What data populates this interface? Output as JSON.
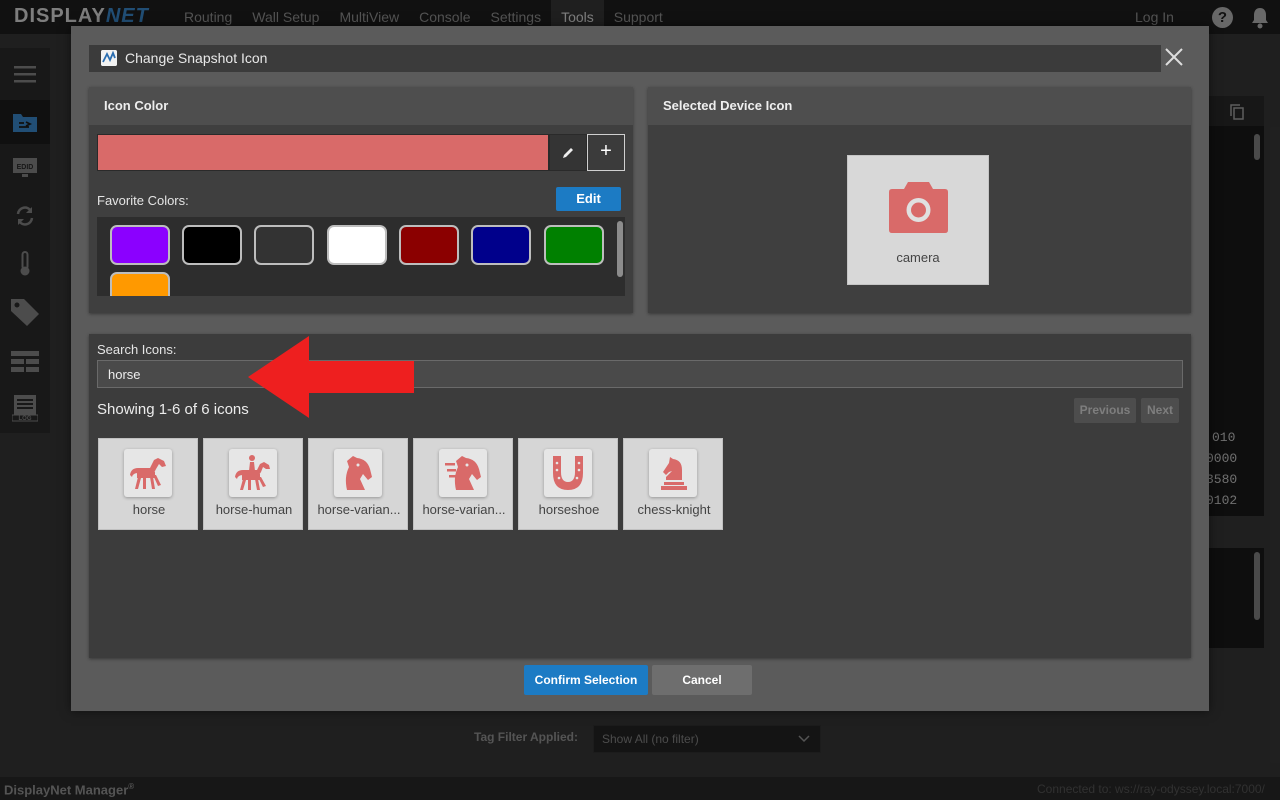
{
  "app": {
    "logo_display": "DISPLAY",
    "logo_net": "NET",
    "nav": [
      "Routing",
      "Wall Setup",
      "MultiView",
      "Console",
      "Settings",
      "Tools",
      "Support"
    ],
    "active_nav": "Tools",
    "login_label": "Log In"
  },
  "background": {
    "code_lines": [
      "010",
      "0000",
      "3580",
      "0102"
    ],
    "tag_filter_label": "Tag Filter Applied:",
    "tag_filter_value": "Show All (no filter)",
    "footer_brand": "DisplayNet Manager",
    "footer_brand_mark": "®",
    "footer_connection": "Connected to: ws://ray-odyssey.local:7000/"
  },
  "modal": {
    "title": "Change Snapshot Icon",
    "icon_color": {
      "heading": "Icon Color",
      "current_color": "#d96a69",
      "favorite_label": "Favorite Colors:",
      "edit_label": "Edit",
      "favorites": [
        "#8b00ff",
        "#000000",
        "#333333",
        "#ffffff",
        "#8b0000",
        "#00008b",
        "#008000",
        "#ff9900"
      ]
    },
    "selected_device": {
      "heading": "Selected Device Icon",
      "icon_name": "camera",
      "label": "camera"
    },
    "search": {
      "label": "Search Icons:",
      "value": "horse",
      "showing": "Showing 1-6 of 6 icons",
      "previous_label": "Previous",
      "next_label": "Next"
    },
    "icons": [
      {
        "name": "horse-icon",
        "label": "horse"
      },
      {
        "name": "horse-human-icon",
        "label": "horse-human"
      },
      {
        "name": "horse-variant-icon",
        "label": "horse-varian..."
      },
      {
        "name": "horse-variant-fast-icon",
        "label": "horse-varian..."
      },
      {
        "name": "horseshoe-icon",
        "label": "horseshoe"
      },
      {
        "name": "chess-knight-icon",
        "label": "chess-knight"
      }
    ],
    "confirm_label": "Confirm Selection",
    "cancel_label": "Cancel"
  }
}
